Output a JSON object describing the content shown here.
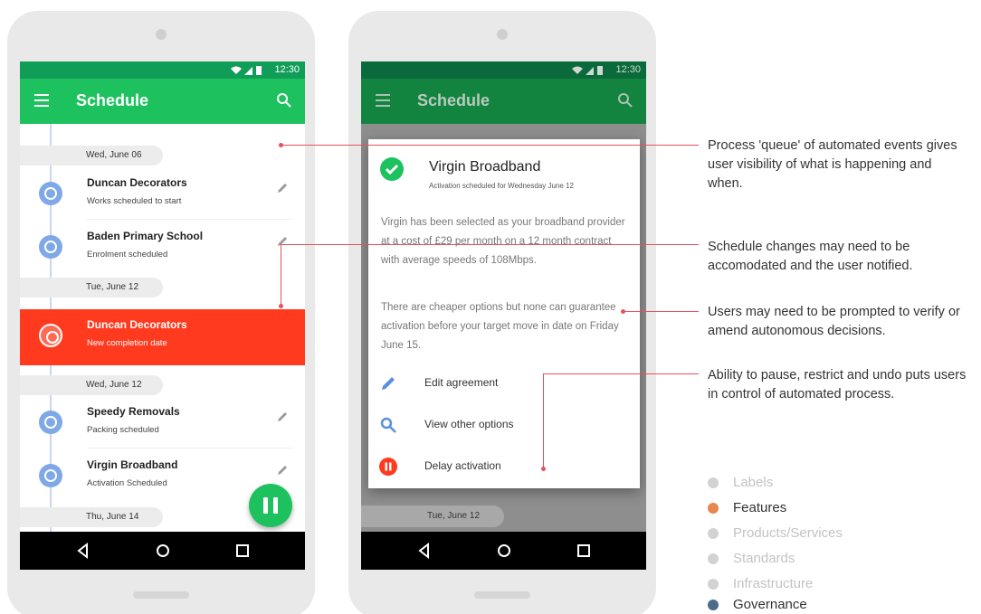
{
  "status": {
    "time": "12:30"
  },
  "app": {
    "title": "Schedule"
  },
  "phone1": {
    "dates": [
      "Wed, June 06",
      "Tue, June 12",
      "Wed, June 12",
      "Thu, June 14"
    ],
    "items": [
      {
        "title": "Duncan Decorators",
        "sub": "Works scheduled to start"
      },
      {
        "title": "Baden Primary School",
        "sub": "Enrolment scheduled"
      },
      {
        "title": "Duncan Decorators",
        "sub": "New completion date"
      },
      {
        "title": "Speedy Removals",
        "sub": "Packing scheduled"
      },
      {
        "title": "Virgin Broadband",
        "sub": "Activation Scheduled"
      }
    ]
  },
  "phone2": {
    "bg_date": "Tue, June 12",
    "dialog": {
      "title": "Virgin Broadband",
      "subtitle": "Activation scheduled for Wednesday June 12",
      "body1": "Virgin has been selected as your broadband provider at a cost of £29 per month on a 12 month contract with average speeds of 108Mbps.",
      "body2": "There are cheaper options but none can guarantee activation before your target move in date on Friday June 15.",
      "actions": [
        {
          "label": "Edit agreement",
          "icon": "pencil-icon"
        },
        {
          "label": "View other options",
          "icon": "search-icon"
        },
        {
          "label": "Delay activation",
          "icon": "pause-icon"
        }
      ]
    }
  },
  "annotations": [
    "Process 'queue' of automated events gives user visibility of what is happening and when.",
    "Schedule changes may need to be accomodated and the user notified.",
    "Users may need to be prompted to verify or amend autonomous decisions.",
    "Ability to pause, restrict and undo puts users in control of automated process."
  ],
  "legend": [
    {
      "label": "Labels",
      "color": "#d2d2d2",
      "active": false
    },
    {
      "label": "Features",
      "color": "#e8864f",
      "active": true
    },
    {
      "label": "Products/Services",
      "color": "#d2d2d2",
      "active": false
    },
    {
      "label": "Standards",
      "color": "#d2d2d2",
      "active": false
    },
    {
      "label": "Infrastructure",
      "color": "#d2d2d2",
      "active": false
    },
    {
      "label": "Governance",
      "color": "#4a6b8a",
      "active": true
    }
  ],
  "colors": {
    "brand_green": "#1dc25f",
    "alert_red": "#ff3a1e",
    "annotation_line": "#e8505b"
  }
}
